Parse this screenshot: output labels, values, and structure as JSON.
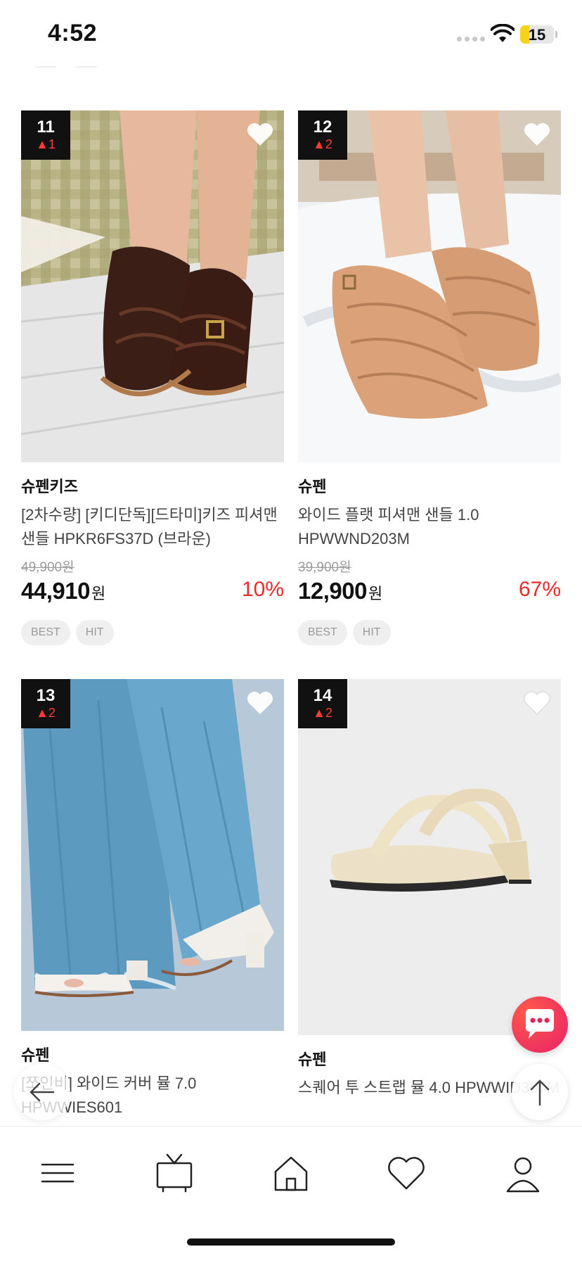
{
  "status_bar": {
    "time": "4:52",
    "battery": "15",
    "battery_level": 0.15
  },
  "products": [
    {
      "rank": "11",
      "rank_change": "▲1",
      "brand": "슈펜키즈",
      "name": "[2차수량] [키디단독][드타미]키즈 피셔맨 샌들 HPKR6FS37D (브라운)",
      "original_price": "49,900원",
      "price": "44,910",
      "currency": "원",
      "discount": "10%",
      "tags": [
        "BEST",
        "HIT"
      ],
      "image": "brown-kids-fisherman-sandal-photo"
    },
    {
      "rank": "12",
      "rank_change": "▲2",
      "brand": "슈펜",
      "name": "와이드 플랫 피셔맨 샌들 1.0 HPWWND203M",
      "original_price": "39,900원",
      "price": "12,900",
      "currency": "원",
      "discount": "67%",
      "tags": [
        "BEST",
        "HIT"
      ],
      "image": "tan-fisherman-sandal-photo"
    },
    {
      "rank": "13",
      "rank_change": "▲2",
      "brand": "슈펜",
      "name": "[쪼인비] 와이드 커버 뮬 7.0 HPWWIES601",
      "image": "white-mule-jeans-photo"
    },
    {
      "rank": "14",
      "rank_change": "▲2",
      "brand": "슈펜",
      "name": "스퀘어 투 스트랩 뮬 4.0 HPWWID307M",
      "image": "cream-strap-mule-photo"
    }
  ],
  "nav": [
    {
      "name": "menu",
      "icon": "menu-icon"
    },
    {
      "name": "live",
      "icon": "tv-icon"
    },
    {
      "name": "home",
      "icon": "home-icon"
    },
    {
      "name": "wishlist",
      "icon": "heart-icon"
    },
    {
      "name": "mypage",
      "icon": "user-icon"
    }
  ],
  "colors": {
    "discount": "#e82c2c",
    "rank_change": "#ff3a3a",
    "chat_fab": "#f03c5a"
  }
}
